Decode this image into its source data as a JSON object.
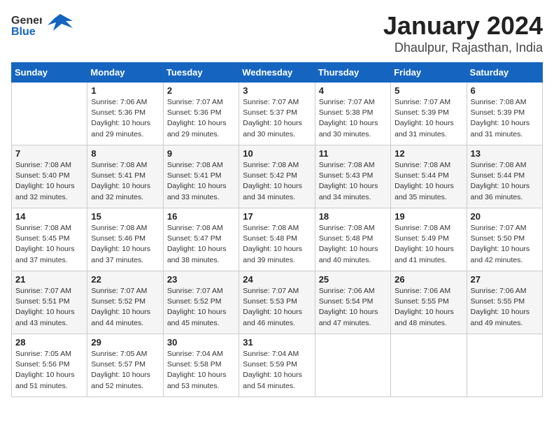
{
  "header": {
    "logo_line1": "General",
    "logo_line2": "Blue",
    "month": "January 2024",
    "location": "Dhaulpur, Rajasthan, India"
  },
  "weekdays": [
    "Sunday",
    "Monday",
    "Tuesday",
    "Wednesday",
    "Thursday",
    "Friday",
    "Saturday"
  ],
  "weeks": [
    [
      {
        "day": "",
        "info": ""
      },
      {
        "day": "1",
        "info": "Sunrise: 7:06 AM\nSunset: 5:36 PM\nDaylight: 10 hours\nand 29 minutes."
      },
      {
        "day": "2",
        "info": "Sunrise: 7:07 AM\nSunset: 5:36 PM\nDaylight: 10 hours\nand 29 minutes."
      },
      {
        "day": "3",
        "info": "Sunrise: 7:07 AM\nSunset: 5:37 PM\nDaylight: 10 hours\nand 30 minutes."
      },
      {
        "day": "4",
        "info": "Sunrise: 7:07 AM\nSunset: 5:38 PM\nDaylight: 10 hours\nand 30 minutes."
      },
      {
        "day": "5",
        "info": "Sunrise: 7:07 AM\nSunset: 5:39 PM\nDaylight: 10 hours\nand 31 minutes."
      },
      {
        "day": "6",
        "info": "Sunrise: 7:08 AM\nSunset: 5:39 PM\nDaylight: 10 hours\nand 31 minutes."
      }
    ],
    [
      {
        "day": "7",
        "info": "Sunrise: 7:08 AM\nSunset: 5:40 PM\nDaylight: 10 hours\nand 32 minutes."
      },
      {
        "day": "8",
        "info": "Sunrise: 7:08 AM\nSunset: 5:41 PM\nDaylight: 10 hours\nand 32 minutes."
      },
      {
        "day": "9",
        "info": "Sunrise: 7:08 AM\nSunset: 5:41 PM\nDaylight: 10 hours\nand 33 minutes."
      },
      {
        "day": "10",
        "info": "Sunrise: 7:08 AM\nSunset: 5:42 PM\nDaylight: 10 hours\nand 34 minutes."
      },
      {
        "day": "11",
        "info": "Sunrise: 7:08 AM\nSunset: 5:43 PM\nDaylight: 10 hours\nand 34 minutes."
      },
      {
        "day": "12",
        "info": "Sunrise: 7:08 AM\nSunset: 5:44 PM\nDaylight: 10 hours\nand 35 minutes."
      },
      {
        "day": "13",
        "info": "Sunrise: 7:08 AM\nSunset: 5:44 PM\nDaylight: 10 hours\nand 36 minutes."
      }
    ],
    [
      {
        "day": "14",
        "info": "Sunrise: 7:08 AM\nSunset: 5:45 PM\nDaylight: 10 hours\nand 37 minutes."
      },
      {
        "day": "15",
        "info": "Sunrise: 7:08 AM\nSunset: 5:46 PM\nDaylight: 10 hours\nand 37 minutes."
      },
      {
        "day": "16",
        "info": "Sunrise: 7:08 AM\nSunset: 5:47 PM\nDaylight: 10 hours\nand 38 minutes."
      },
      {
        "day": "17",
        "info": "Sunrise: 7:08 AM\nSunset: 5:48 PM\nDaylight: 10 hours\nand 39 minutes."
      },
      {
        "day": "18",
        "info": "Sunrise: 7:08 AM\nSunset: 5:48 PM\nDaylight: 10 hours\nand 40 minutes."
      },
      {
        "day": "19",
        "info": "Sunrise: 7:08 AM\nSunset: 5:49 PM\nDaylight: 10 hours\nand 41 minutes."
      },
      {
        "day": "20",
        "info": "Sunrise: 7:07 AM\nSunset: 5:50 PM\nDaylight: 10 hours\nand 42 minutes."
      }
    ],
    [
      {
        "day": "21",
        "info": "Sunrise: 7:07 AM\nSunset: 5:51 PM\nDaylight: 10 hours\nand 43 minutes."
      },
      {
        "day": "22",
        "info": "Sunrise: 7:07 AM\nSunset: 5:52 PM\nDaylight: 10 hours\nand 44 minutes."
      },
      {
        "day": "23",
        "info": "Sunrise: 7:07 AM\nSunset: 5:52 PM\nDaylight: 10 hours\nand 45 minutes."
      },
      {
        "day": "24",
        "info": "Sunrise: 7:07 AM\nSunset: 5:53 PM\nDaylight: 10 hours\nand 46 minutes."
      },
      {
        "day": "25",
        "info": "Sunrise: 7:06 AM\nSunset: 5:54 PM\nDaylight: 10 hours\nand 47 minutes."
      },
      {
        "day": "26",
        "info": "Sunrise: 7:06 AM\nSunset: 5:55 PM\nDaylight: 10 hours\nand 48 minutes."
      },
      {
        "day": "27",
        "info": "Sunrise: 7:06 AM\nSunset: 5:55 PM\nDaylight: 10 hours\nand 49 minutes."
      }
    ],
    [
      {
        "day": "28",
        "info": "Sunrise: 7:05 AM\nSunset: 5:56 PM\nDaylight: 10 hours\nand 51 minutes."
      },
      {
        "day": "29",
        "info": "Sunrise: 7:05 AM\nSunset: 5:57 PM\nDaylight: 10 hours\nand 52 minutes."
      },
      {
        "day": "30",
        "info": "Sunrise: 7:04 AM\nSunset: 5:58 PM\nDaylight: 10 hours\nand 53 minutes."
      },
      {
        "day": "31",
        "info": "Sunrise: 7:04 AM\nSunset: 5:59 PM\nDaylight: 10 hours\nand 54 minutes."
      },
      {
        "day": "",
        "info": ""
      },
      {
        "day": "",
        "info": ""
      },
      {
        "day": "",
        "info": ""
      }
    ]
  ]
}
